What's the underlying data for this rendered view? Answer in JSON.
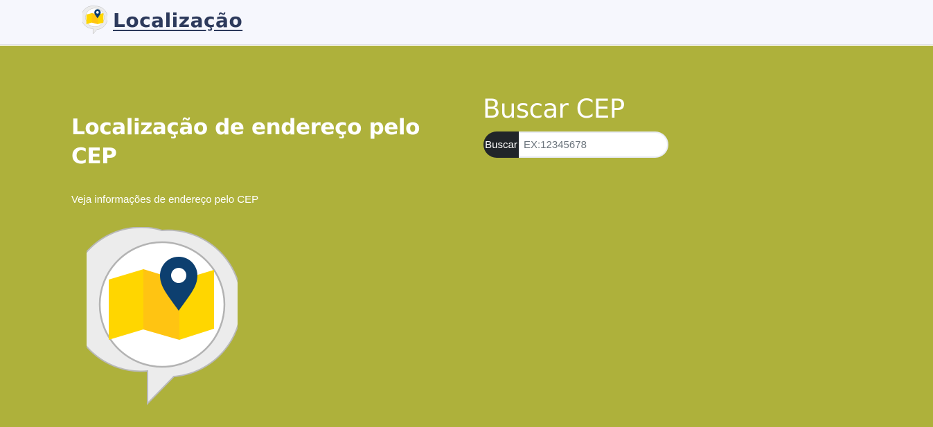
{
  "navbar": {
    "brand_label": "Localização",
    "brand_icon": "map-pin-icon"
  },
  "hero": {
    "title": "Localização de endereço pelo CEP",
    "subtitle": "Veja informações de endereço pelo CEP",
    "image_icon": "map-location-icon"
  },
  "search": {
    "title": "Buscar CEP",
    "button_label": "Buscar",
    "input_value": "",
    "input_placeholder": "EX:12345678"
  },
  "colors": {
    "navbar_bg": "#f6f7fd",
    "hero_bg": "#aeb13b",
    "brand_text": "#2d3a5c",
    "button_bg": "#212529",
    "map_yellow": "#ffd600",
    "pin_blue": "#0d3f6f"
  }
}
